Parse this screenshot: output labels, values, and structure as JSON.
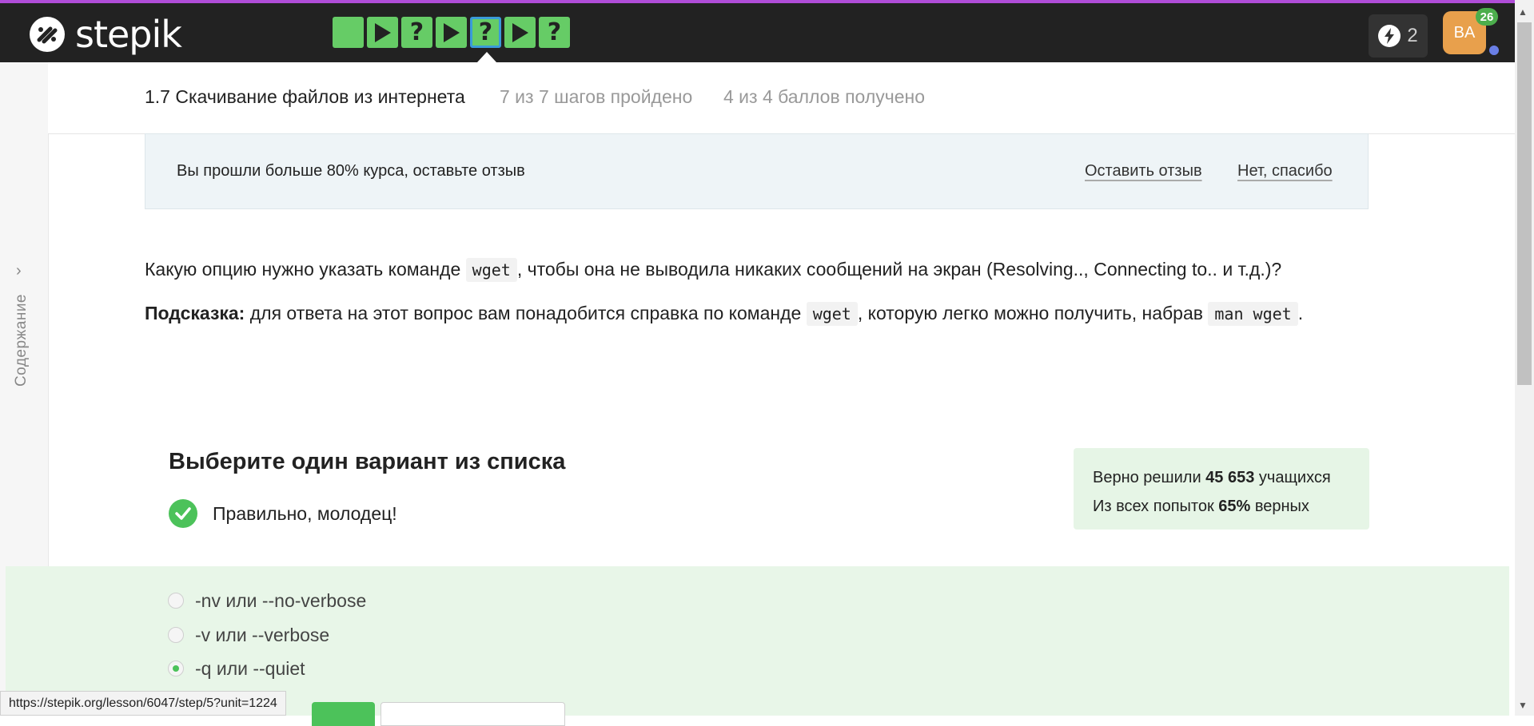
{
  "app": {
    "name": "stepik"
  },
  "navbar": {
    "steps": [
      {
        "type": "text",
        "icon": "text-step-icon",
        "status": "passed"
      },
      {
        "type": "video",
        "icon": "play-icon",
        "status": "passed"
      },
      {
        "type": "quiz",
        "icon": "question-icon",
        "glyph": "?",
        "status": "passed"
      },
      {
        "type": "video",
        "icon": "play-icon",
        "status": "passed"
      },
      {
        "type": "quiz",
        "icon": "question-icon",
        "glyph": "?",
        "status": "passed",
        "current": true
      },
      {
        "type": "video",
        "icon": "play-icon",
        "status": "passed"
      },
      {
        "type": "quiz",
        "icon": "question-icon",
        "glyph": "?",
        "status": "passed"
      }
    ],
    "energy_count": "2",
    "avatar_initials": "BA",
    "notifications_count": "26"
  },
  "sidebar": {
    "toggle_label": "Содержание"
  },
  "lesson": {
    "title": "1.7 Скачивание файлов из интернета",
    "progress": "7 из 7 шагов пройдено",
    "score": "4 из 4 баллов  получено"
  },
  "feedback_banner": {
    "text": "Вы прошли больше 80% курса, оставьте отзыв",
    "leave_review": "Оставить отзыв",
    "no_thanks": "Нет, спасибо"
  },
  "question": {
    "part1": "Какую опцию нужно указать команде ",
    "code1": "wget",
    "part2": ", чтобы она не выводила никаких сообщений на экран (Resolving.., Connecting to.. и т.д.)?",
    "hint_label": "Подсказка:",
    "hint_part1": " для ответа на этот вопрос вам понадобится справка по команде ",
    "hint_code1": "wget",
    "hint_part2": ", которую легко можно получить, набрав ",
    "hint_code2": "man wget",
    "hint_end": "."
  },
  "quiz": {
    "title": "Выберите один вариант из списка",
    "result": "Правильно, молодец!",
    "stats": {
      "solved_prefix": "Верно решили ",
      "solved_count": "45 653",
      "solved_suffix": " учащихся",
      "attempts_prefix": "Из всех попыток ",
      "attempts_pct": "65%",
      "attempts_suffix": " верных"
    },
    "options": [
      {
        "label": "-nv или --no-verbose",
        "checked": false
      },
      {
        "label": "-v или --verbose",
        "checked": false
      },
      {
        "label": "-q или --quiet",
        "checked": true
      }
    ]
  },
  "status_bar": {
    "url": "https://stepik.org/lesson/6047/step/5?unit=1224"
  },
  "colors": {
    "accent": "#66cc66",
    "success": "#4cc25a",
    "navbar": "#222222",
    "topline": "#b04dd8",
    "avatar": "#e8a04c"
  }
}
